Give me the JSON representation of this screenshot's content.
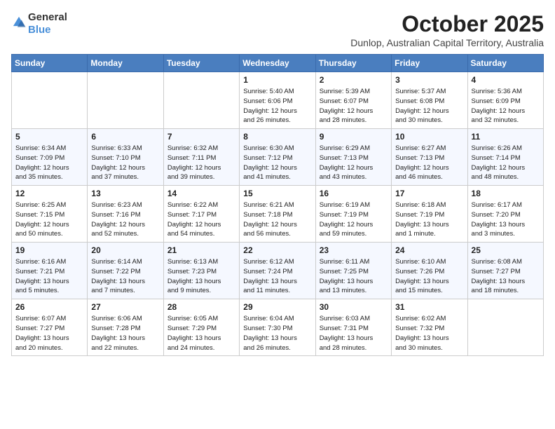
{
  "logo": {
    "general": "General",
    "blue": "Blue"
  },
  "title": "October 2025",
  "subtitle": "Dunlop, Australian Capital Territory, Australia",
  "headers": [
    "Sunday",
    "Monday",
    "Tuesday",
    "Wednesday",
    "Thursday",
    "Friday",
    "Saturday"
  ],
  "weeks": [
    [
      {
        "day": "",
        "info": ""
      },
      {
        "day": "",
        "info": ""
      },
      {
        "day": "",
        "info": ""
      },
      {
        "day": "1",
        "info": "Sunrise: 5:40 AM\nSunset: 6:06 PM\nDaylight: 12 hours\nand 26 minutes."
      },
      {
        "day": "2",
        "info": "Sunrise: 5:39 AM\nSunset: 6:07 PM\nDaylight: 12 hours\nand 28 minutes."
      },
      {
        "day": "3",
        "info": "Sunrise: 5:37 AM\nSunset: 6:08 PM\nDaylight: 12 hours\nand 30 minutes."
      },
      {
        "day": "4",
        "info": "Sunrise: 5:36 AM\nSunset: 6:09 PM\nDaylight: 12 hours\nand 32 minutes."
      }
    ],
    [
      {
        "day": "5",
        "info": "Sunrise: 6:34 AM\nSunset: 7:09 PM\nDaylight: 12 hours\nand 35 minutes."
      },
      {
        "day": "6",
        "info": "Sunrise: 6:33 AM\nSunset: 7:10 PM\nDaylight: 12 hours\nand 37 minutes."
      },
      {
        "day": "7",
        "info": "Sunrise: 6:32 AM\nSunset: 7:11 PM\nDaylight: 12 hours\nand 39 minutes."
      },
      {
        "day": "8",
        "info": "Sunrise: 6:30 AM\nSunset: 7:12 PM\nDaylight: 12 hours\nand 41 minutes."
      },
      {
        "day": "9",
        "info": "Sunrise: 6:29 AM\nSunset: 7:13 PM\nDaylight: 12 hours\nand 43 minutes."
      },
      {
        "day": "10",
        "info": "Sunrise: 6:27 AM\nSunset: 7:13 PM\nDaylight: 12 hours\nand 46 minutes."
      },
      {
        "day": "11",
        "info": "Sunrise: 6:26 AM\nSunset: 7:14 PM\nDaylight: 12 hours\nand 48 minutes."
      }
    ],
    [
      {
        "day": "12",
        "info": "Sunrise: 6:25 AM\nSunset: 7:15 PM\nDaylight: 12 hours\nand 50 minutes."
      },
      {
        "day": "13",
        "info": "Sunrise: 6:23 AM\nSunset: 7:16 PM\nDaylight: 12 hours\nand 52 minutes."
      },
      {
        "day": "14",
        "info": "Sunrise: 6:22 AM\nSunset: 7:17 PM\nDaylight: 12 hours\nand 54 minutes."
      },
      {
        "day": "15",
        "info": "Sunrise: 6:21 AM\nSunset: 7:18 PM\nDaylight: 12 hours\nand 56 minutes."
      },
      {
        "day": "16",
        "info": "Sunrise: 6:19 AM\nSunset: 7:19 PM\nDaylight: 12 hours\nand 59 minutes."
      },
      {
        "day": "17",
        "info": "Sunrise: 6:18 AM\nSunset: 7:19 PM\nDaylight: 13 hours\nand 1 minute."
      },
      {
        "day": "18",
        "info": "Sunrise: 6:17 AM\nSunset: 7:20 PM\nDaylight: 13 hours\nand 3 minutes."
      }
    ],
    [
      {
        "day": "19",
        "info": "Sunrise: 6:16 AM\nSunset: 7:21 PM\nDaylight: 13 hours\nand 5 minutes."
      },
      {
        "day": "20",
        "info": "Sunrise: 6:14 AM\nSunset: 7:22 PM\nDaylight: 13 hours\nand 7 minutes."
      },
      {
        "day": "21",
        "info": "Sunrise: 6:13 AM\nSunset: 7:23 PM\nDaylight: 13 hours\nand 9 minutes."
      },
      {
        "day": "22",
        "info": "Sunrise: 6:12 AM\nSunset: 7:24 PM\nDaylight: 13 hours\nand 11 minutes."
      },
      {
        "day": "23",
        "info": "Sunrise: 6:11 AM\nSunset: 7:25 PM\nDaylight: 13 hours\nand 13 minutes."
      },
      {
        "day": "24",
        "info": "Sunrise: 6:10 AM\nSunset: 7:26 PM\nDaylight: 13 hours\nand 15 minutes."
      },
      {
        "day": "25",
        "info": "Sunrise: 6:08 AM\nSunset: 7:27 PM\nDaylight: 13 hours\nand 18 minutes."
      }
    ],
    [
      {
        "day": "26",
        "info": "Sunrise: 6:07 AM\nSunset: 7:27 PM\nDaylight: 13 hours\nand 20 minutes."
      },
      {
        "day": "27",
        "info": "Sunrise: 6:06 AM\nSunset: 7:28 PM\nDaylight: 13 hours\nand 22 minutes."
      },
      {
        "day": "28",
        "info": "Sunrise: 6:05 AM\nSunset: 7:29 PM\nDaylight: 13 hours\nand 24 minutes."
      },
      {
        "day": "29",
        "info": "Sunrise: 6:04 AM\nSunset: 7:30 PM\nDaylight: 13 hours\nand 26 minutes."
      },
      {
        "day": "30",
        "info": "Sunrise: 6:03 AM\nSunset: 7:31 PM\nDaylight: 13 hours\nand 28 minutes."
      },
      {
        "day": "31",
        "info": "Sunrise: 6:02 AM\nSunset: 7:32 PM\nDaylight: 13 hours\nand 30 minutes."
      },
      {
        "day": "",
        "info": ""
      }
    ]
  ]
}
